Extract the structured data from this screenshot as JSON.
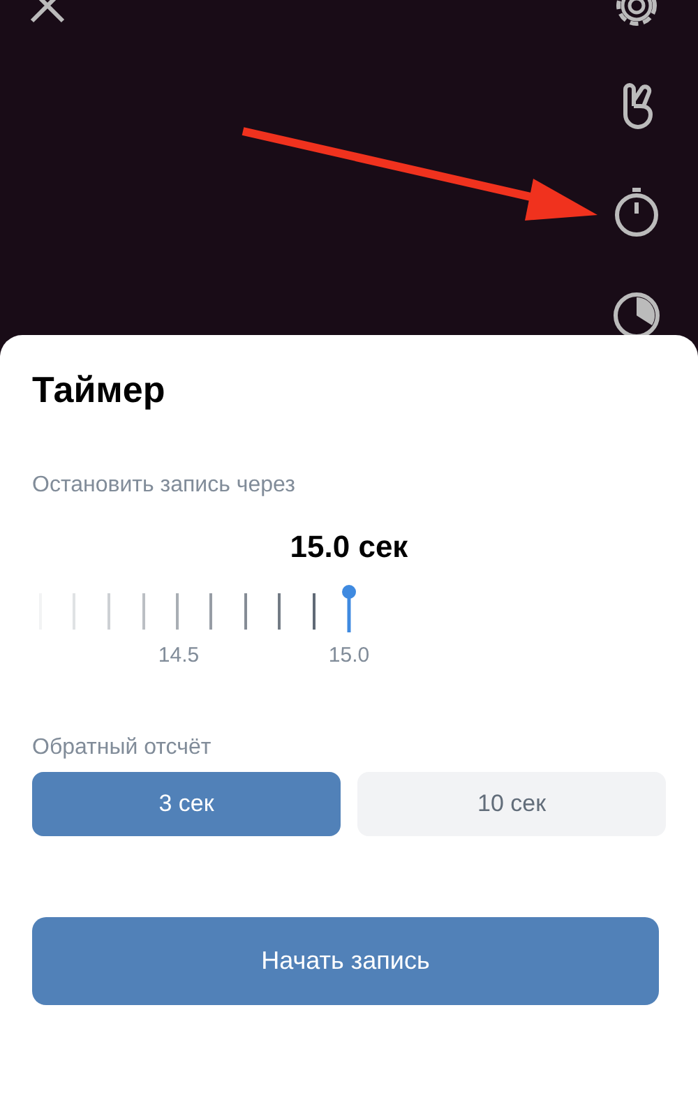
{
  "sheet": {
    "title": "Таймер",
    "stop_label": "Остановить запись через",
    "value": "15.0 сек",
    "scale_labels": [
      "14.5",
      "15.0"
    ],
    "countdown_label": "Обратный отсчёт",
    "countdown_options": [
      {
        "label": "3 сек",
        "selected": true
      },
      {
        "label": "10 сек",
        "selected": false
      }
    ],
    "start_button": "Начать запись"
  }
}
